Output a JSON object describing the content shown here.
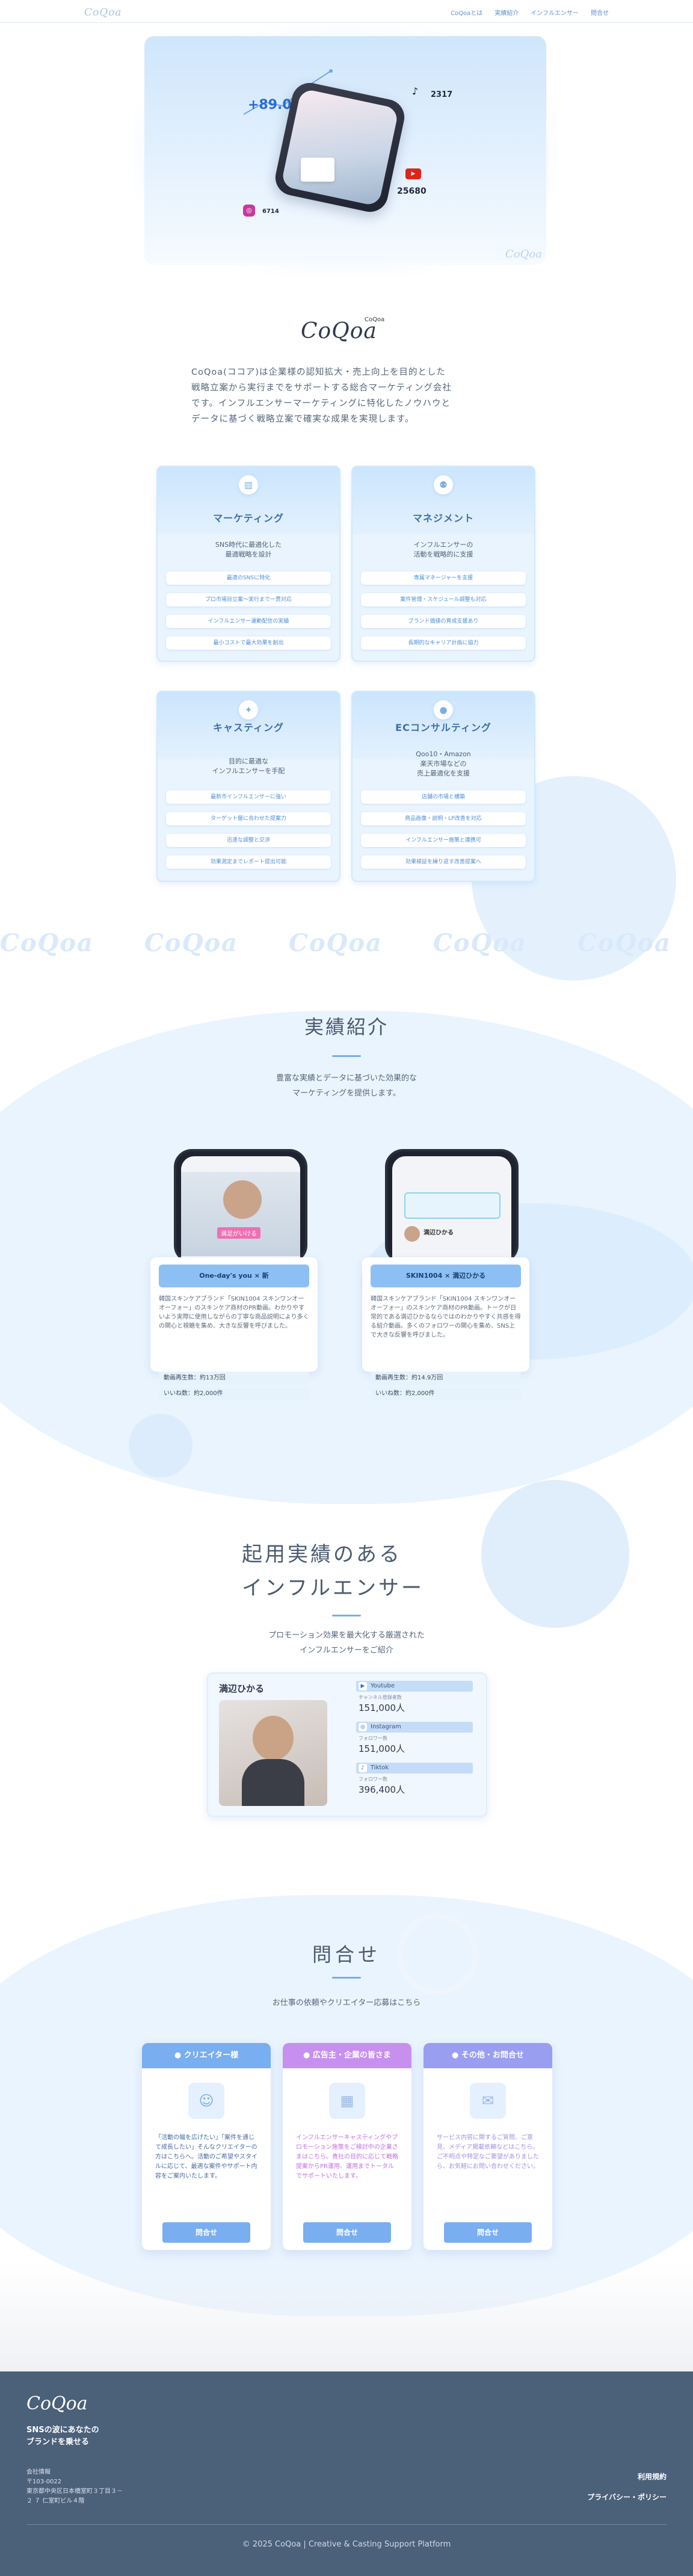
{
  "nav": {
    "logo": "CoQoa",
    "links": [
      "CoQoaとは",
      "実績紹介",
      "インフルエンサー",
      "問合せ"
    ]
  },
  "hero": {
    "stat_percent": "+89.0%",
    "tiktok_icon": "♪",
    "tiktok_value": "2317",
    "youtube_icon": "▶",
    "youtube_value": "25680",
    "instagram_icon": "◎",
    "instagram_value": "6714",
    "corner_mark": "CoQoa"
  },
  "about": {
    "logo_main": "CoQoa",
    "logo_sup": "CoQoa",
    "paragraph_lines": [
      "CoQoa(ココア)は企業様の認知拡大・売上向上を目的とした",
      "戦略立案から実行までをサポートする総合マーケティング会社",
      "です。インフルエンサーマーケティングに特化したノウハウと",
      "データに基づく戦略立案で確実な成果を実現します。"
    ]
  },
  "services": [
    {
      "title": "マーケティング",
      "icon": "chart-icon",
      "glyph": "▥",
      "sub": [
        "SNS時代に最適化した",
        "最適戦略を設計"
      ],
      "items": [
        "最適のSNSに特化",
        "プロ市場目立案〜実行まで一貫対応",
        "インフルエンサー運動配信の実績",
        "最小コストで最大効果を創出"
      ]
    },
    {
      "title": "マネジメント",
      "icon": "team-icon",
      "glyph": "⚉",
      "sub": [
        "インフルエンサーの",
        "活動を戦略的に支援"
      ],
      "items": [
        "専属マネージャーを支援",
        "案件管理・スケジュール調整も対応",
        "ブランド価値の育成支援あり",
        "長期的なキャリア計画に協力"
      ]
    },
    {
      "title": "キャスティング",
      "icon": "star-icon",
      "glyph": "✦",
      "sub": [
        "目的に最適な",
        "インフルエンサーを手配"
      ],
      "items": [
        "最新市インフルエンサーに強い",
        "ターゲット層に合わせた提案力",
        "迅速な調整と交渉",
        "効果測定までレポート提出可能"
      ]
    },
    {
      "title": "ECコンサルティング",
      "icon": "bulb-icon",
      "glyph": "●",
      "sub": [
        "Qoo10・Amazon",
        "楽天市場などの",
        "売上最適化を支援"
      ],
      "items": [
        "店舗の市場と構築",
        "商品画像・説明・LP改善を対応",
        "インフルエンサー施策と連携可",
        "効果検証を繰り返す改善提案へ"
      ]
    }
  ],
  "watermark": "CoQoa",
  "works": {
    "title": "実績紹介",
    "lead": [
      "豊富な実績とデータに基づいた効果的な",
      "マーケティングを提供します。"
    ],
    "items": [
      {
        "tag": "One-day's you × 新",
        "text": "韓国スキンケアブランド「SKIN1004 スキンワンオーオーフォー」のスキンケア商材のPR動画。わかりやすいよう実際に使用しながらの丁寧な商品説明により多くの関心と視聴を集め、大きな反響を呼びました。",
        "views": "動画再生数：約13万回",
        "likes": "いいね数：約2,000件",
        "screen_caption": "満足がいける"
      },
      {
        "tag": "SKIN1004 × 満辺ひかる",
        "text": "韓国スキンケアブランド「SKIN1004 スキンワンオーオーフォー」のスキンケア商材のPR動画。トークが日常的である満辺ひかるならではのわかりやすく共感を得る紹介動画。多くのフォロワーの関心を集め、SNS上で大きな反響を呼びました。",
        "views": "動画再生数：約14.9万回",
        "likes": "いいね数：約2,000件",
        "screen_caption": "満辺ひかる"
      }
    ]
  },
  "influencers": {
    "title_line1": "起用実績のある",
    "title_line2": "インフルエンサー",
    "lead": [
      "プロモーション効果を最大化する厳選された",
      "インフルエンサーをご紹介"
    ],
    "name": "満辺ひかる",
    "sns": [
      {
        "platform": "Youtube",
        "glyph": "▶",
        "caption": "チャンネル登録者数",
        "value": "151,000人"
      },
      {
        "platform": "Instagram",
        "glyph": "◎",
        "caption": "フォロワー数",
        "value": "151,000人"
      },
      {
        "platform": "Tiktok",
        "glyph": "♪",
        "caption": "フォロワー数",
        "value": "396,400人"
      }
    ]
  },
  "contact": {
    "title": "問合せ",
    "lead": "お仕事の依頼やクリエイター応募はこちら",
    "cards": [
      {
        "head": "クリエイター様",
        "head_glyph": "●",
        "glyph": "☺",
        "color": "#79aef0",
        "iconbg": "#e4f0fd",
        "textcolor": "#4a6aa0",
        "text": "「活動の幅を広げたい」「案件を通じて成長したい」そんなクリエイターの方はこちらへ。活動のご希望やスタイルに応じて、最適な案件やサポート内容をご案内いたします。",
        "button": "問合せ"
      },
      {
        "head": "広告主・企業の皆さま",
        "head_glyph": "●",
        "glyph": "▦",
        "color": "#c790ef",
        "iconbg": "#e4f0fd",
        "textcolor": "#c071e0",
        "text": "インフルエンサーキャスティングやプロモーション施策をご検討中の企業さまはこちら。貴社の目的に応じて戦略提案からPR運用、運用までトータルでサポートいたします。",
        "button": "問合せ"
      },
      {
        "head": "その他・お問合せ",
        "head_glyph": "●",
        "glyph": "✉",
        "color": "#9a9ef0",
        "iconbg": "#e4f0fd",
        "textcolor": "#a48ee0",
        "text": "サービス内容に関するご質問、ご意見、メディア掲載依頼などはこちら。ご不明点や特定なご要望がありましたら、お気軽にお問い合わせください。",
        "button": "問合せ"
      }
    ]
  },
  "footer": {
    "logo": "CoQoa",
    "tagline_1": "SNSの波にあなたの",
    "tagline_2": "ブランドを乗せる",
    "address_label": "会社情報",
    "address_zip": "〒103-0022",
    "address_1": "東京都中央区日本橋室町３丁目３－",
    "address_2": "２ ７ 仁室町ビル４階",
    "link_terms": "利用規約",
    "link_privacy": "プライバシー・ポリシー",
    "copyright": "© 2025 CoQoa | Creative & Casting Support Platform"
  }
}
